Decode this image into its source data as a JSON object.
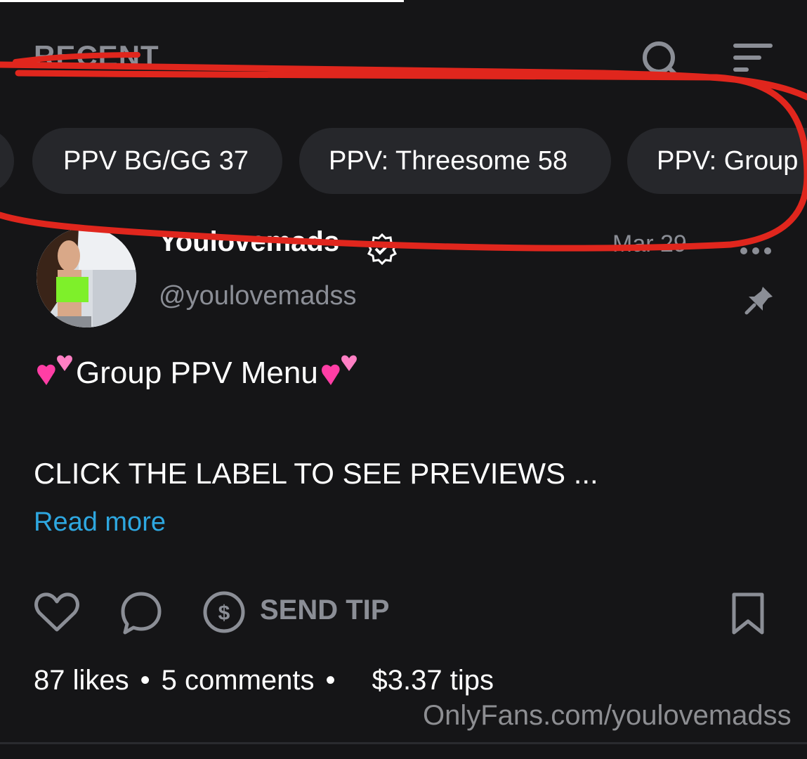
{
  "header": {
    "title": "RECENT"
  },
  "filters": [
    {
      "label": "PPV BG/GG 37"
    },
    {
      "label": "PPV: Threesome 58"
    },
    {
      "label": "PPV: Group"
    }
  ],
  "post": {
    "author": {
      "display_name": "Youlovemads",
      "handle": "@youlovemadss",
      "verified": true
    },
    "date": "Mar 29",
    "title": "Group PPV Menu",
    "body": "CLICK THE LABEL TO SEE PREVIEWS ...",
    "read_more": "Read more",
    "actions": {
      "send_tip": "SEND TIP"
    },
    "stats": {
      "likes": "87 likes",
      "comments": "5 comments",
      "tips": "$3.37 tips"
    }
  },
  "watermark": "OnlyFans.com/youlovemadss",
  "icons": [
    "search-icon",
    "sort-icon",
    "verified-icon",
    "more-icon",
    "pin-icon",
    "heart-emoji-icon",
    "like-icon",
    "comment-icon",
    "tip-icon",
    "bookmark-icon"
  ],
  "colors": {
    "background": "#151517",
    "chip": "#26272b",
    "muted": "#8b8e96",
    "link": "#2ea7e0",
    "annotation": "#e0261d"
  }
}
